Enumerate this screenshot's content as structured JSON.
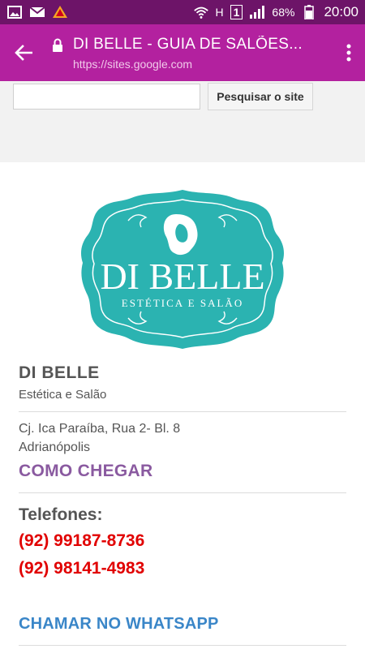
{
  "status_bar": {
    "battery_percent": "68%",
    "time": "20:00",
    "sim_slot": "1",
    "network_type": "H",
    "icons": [
      "gallery-icon",
      "gmail-icon",
      "notification-icon",
      "wifi-icon",
      "signal-icon",
      "battery-icon"
    ]
  },
  "toolbar": {
    "title": "DI BELLE - GUIA DE SALÕES...",
    "url": "https://sites.google.com"
  },
  "search": {
    "value": "",
    "button_label": "Pesquisar o site"
  },
  "logo": {
    "name": "DI BELLE",
    "tagline": "ESTÉTICA E SALÃO",
    "color": "#2bb3b1"
  },
  "business": {
    "name": "DI BELLE",
    "subtitle": "Estética e Salão",
    "address_line1": "Cj. Ica Paraíba, Rua 2- Bl. 8",
    "address_line2": "Adrianópolis",
    "directions_label": "COMO CHEGAR",
    "phones_label": "Telefones:",
    "phones": [
      "(92) 99187-8736",
      "(92) 98141-4983"
    ],
    "whatsapp_label": "CHAMAR NO WHATSAPP"
  },
  "colors": {
    "status_bar": "#6d1468",
    "toolbar": "#b3219f",
    "directions": "#8a5aa0",
    "phone": "#e10000",
    "whatsapp": "#3a86c8"
  }
}
